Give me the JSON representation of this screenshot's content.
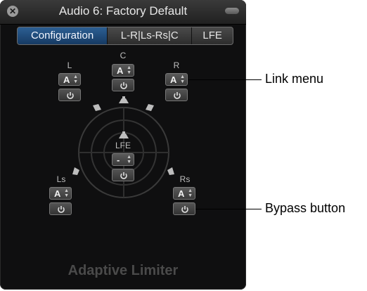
{
  "window": {
    "title": "Audio 6: Factory Default"
  },
  "tabs": [
    {
      "label": "Configuration",
      "active": true
    },
    {
      "label": "L-R|Ls-Rs|C",
      "active": false
    },
    {
      "label": "LFE",
      "active": false
    }
  ],
  "channels": {
    "L": {
      "label": "L",
      "link": "A"
    },
    "C": {
      "label": "C",
      "link": "A"
    },
    "R": {
      "label": "R",
      "link": "A"
    },
    "LFE": {
      "label": "LFE",
      "link": "-"
    },
    "Ls": {
      "label": "Ls",
      "link": "A"
    },
    "Rs": {
      "label": "Rs",
      "link": "A"
    }
  },
  "plugin_name": "Adaptive Limiter",
  "callouts": {
    "link_menu": "Link menu",
    "bypass_button": "Bypass button"
  },
  "colors": {
    "window_bg": "#0f0f10",
    "active_tab": "#2c5f93",
    "panner_ring": "#3a3a3a"
  }
}
